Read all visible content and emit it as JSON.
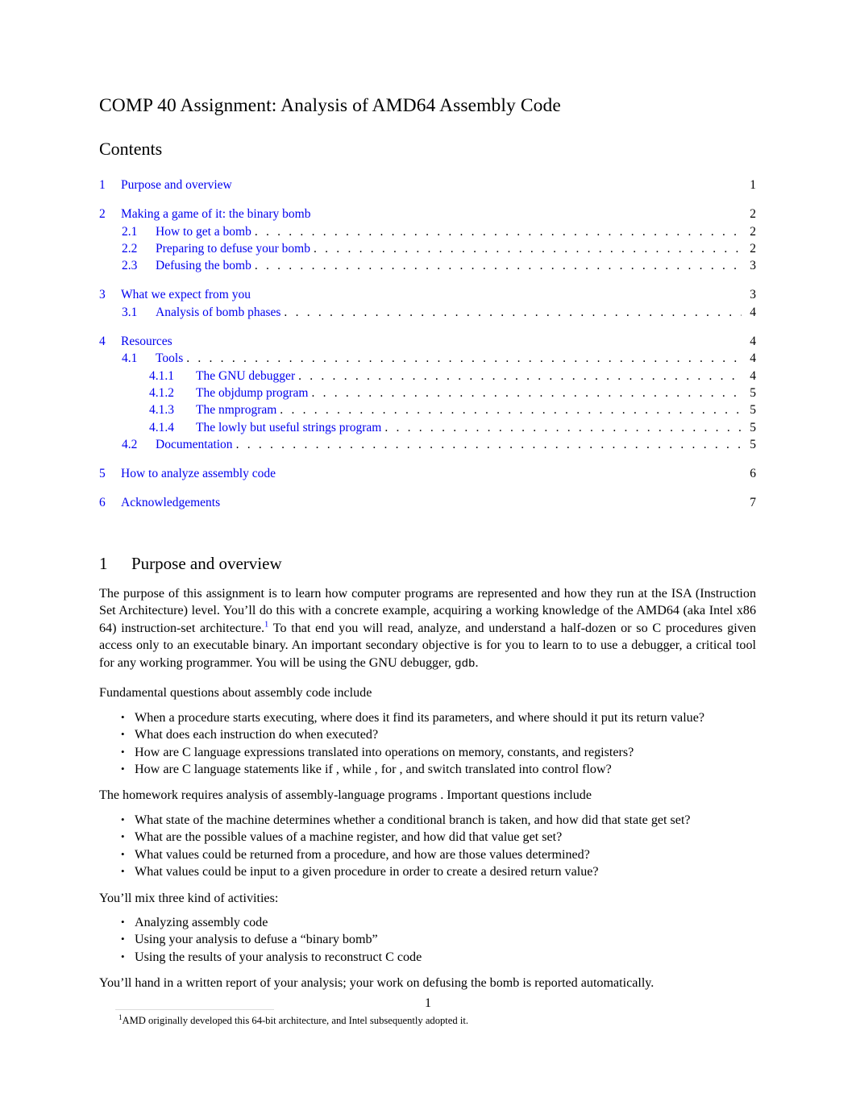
{
  "document": {
    "title": "COMP 40 Assignment: Analysis of AMD64 Assembly Code",
    "contents_heading": "Contents",
    "page_number": "1",
    "link_color": "#0000EE",
    "text_color": "#000000"
  },
  "toc": {
    "groups": [
      {
        "entries": [
          {
            "number": "1",
            "label": "Purpose and overview",
            "page": "1",
            "level": 1,
            "dots": false
          }
        ]
      },
      {
        "entries": [
          {
            "number": "2",
            "label": "Making a game of it: the binary bomb",
            "page": "2",
            "level": 1,
            "dots": false
          },
          {
            "number": "2.1",
            "label": "How to get a bomb",
            "page": "2",
            "level": 2,
            "dots": true
          },
          {
            "number": "2.2",
            "label": "Preparing to defuse your bomb",
            "page": "2",
            "level": 2,
            "dots": true
          },
          {
            "number": "2.3",
            "label": "Defusing the bomb",
            "page": "3",
            "level": 2,
            "dots": true
          }
        ]
      },
      {
        "entries": [
          {
            "number": "3",
            "label": "What we expect from you",
            "page": "3",
            "level": 1,
            "dots": false
          },
          {
            "number": "3.1",
            "label": "Analysis of bomb phases",
            "page": "4",
            "level": 2,
            "dots": true
          }
        ]
      },
      {
        "entries": [
          {
            "number": "4",
            "label": "Resources",
            "page": "4",
            "level": 1,
            "dots": false
          },
          {
            "number": "4.1",
            "label": "Tools",
            "page": "4",
            "level": 2,
            "dots": true
          },
          {
            "number": "4.1.1",
            "label": "The GNU debugger",
            "page": "4",
            "level": 3,
            "dots": true
          },
          {
            "number": "4.1.2",
            "label": "The objdump  program",
            "page": "5",
            "level": 3,
            "dots": true
          },
          {
            "number": "4.1.3",
            "label": "The nmprogram",
            "page": "5",
            "level": 3,
            "dots": true
          },
          {
            "number": "4.1.4",
            "label": "The lowly but useful strings    program",
            "page": "5",
            "level": 3,
            "dots": true
          },
          {
            "number": "4.2",
            "label": "Documentation",
            "page": "5",
            "level": 2,
            "dots": true
          }
        ]
      },
      {
        "entries": [
          {
            "number": "5",
            "label": "How to analyze assembly code",
            "page": "6",
            "level": 1,
            "dots": false
          }
        ]
      },
      {
        "entries": [
          {
            "number": "6",
            "label": "Acknowledgements",
            "page": "7",
            "level": 1,
            "dots": false
          }
        ]
      }
    ]
  },
  "section1": {
    "number": "1",
    "heading": "Purpose and overview",
    "para1_part1": "The purpose of this assignment is to learn how computer programs are represented and how they run at the ISA (Instruction Set Architecture) level. You’ll do this with a concrete example, acquiring a working knowledge of the AMD64 (aka Intel x86 64) instruction-set architecture.",
    "para1_footnote_marker": "1",
    "para1_part2": " To that end you will read, analyze, and understand a half-dozen or so C procedures given access only to an executable binary. An important secondary objective is for you to learn to to use a debugger, a critical tool for any working programmer. You will be using the GNU debugger, ",
    "para1_code": "gdb",
    "para1_part3": ".",
    "para2": "Fundamental questions about assembly code include",
    "bullets1": [
      "When a procedure starts executing, where does it find its parameters, and where should it put its return value?",
      "What does each instruction do when executed?",
      "How are C language expressions translated into operations on memory, constants, and registers?",
      "How are C language statements like if , while , for , and switch   translated into control flow?"
    ],
    "para3": "The homework requires analysis of assembly-language programs . Important questions include",
    "bullets2": [
      "What state of the machine determines whether a conditional branch is taken, and how did that state get set?",
      "What are the possible values of a machine register, and how did that value get set?",
      "What values could be returned from a procedure, and how are those values determined?",
      "What values could be input to a given procedure in order to create a desired return value?"
    ],
    "para4": "You’ll mix three kind of activities:",
    "bullets3": [
      "Analyzing assembly code",
      "Using your analysis to defuse a “binary bomb”",
      "Using the results of your analysis to reconstruct C code"
    ],
    "para5": "You’ll hand in a written report of your analysis; your work on defusing the bomb is reported automatically."
  },
  "footnote": {
    "marker": "1",
    "text": "AMD originally developed this 64-bit architecture, and Intel subsequently adopted it."
  }
}
